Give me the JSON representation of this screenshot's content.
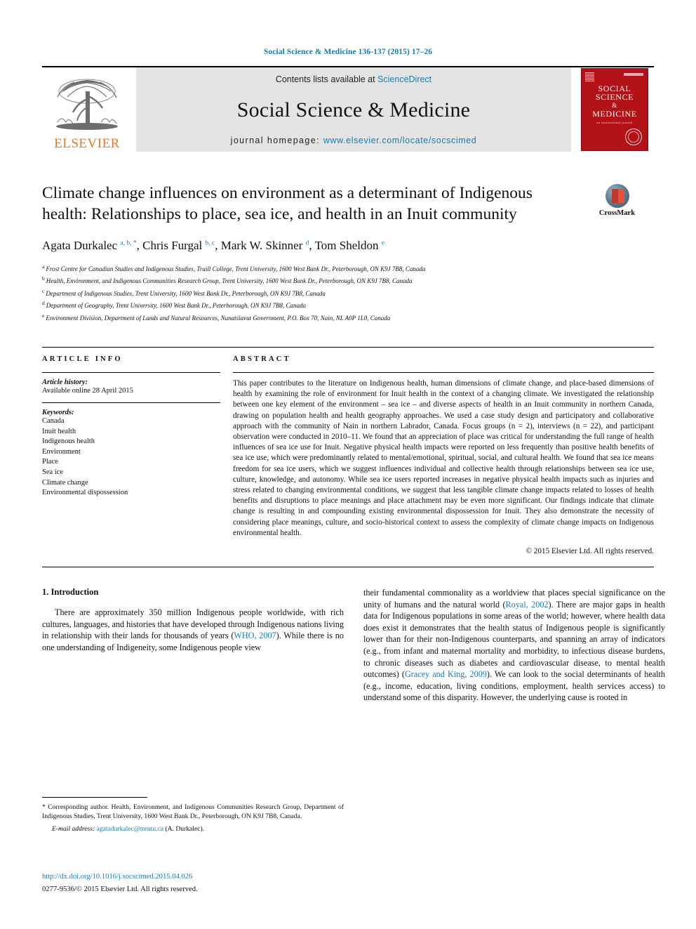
{
  "running_head": "Social Science & Medicine 136-137 (2015) 17–26",
  "header": {
    "elsevier_label": "ELSEVIER",
    "contents_prefix": "Contents lists available at ",
    "contents_link": "ScienceDirect",
    "journal_title": "Social Science & Medicine",
    "homepage_prefix": "journal homepage: ",
    "homepage_url": "www.elsevier.com/locate/socscimed",
    "cover": {
      "line1": "SOCIAL",
      "line2": "SCIENCE",
      "line3": "&",
      "line4": "MEDICINE",
      "subline": "an international journal"
    }
  },
  "crossmark": {
    "label": "CrossMark"
  },
  "article": {
    "title": "Climate change influences on environment as a determinant of Indigenous health: Relationships to place, sea ice, and health in an Inuit community",
    "authors": [
      {
        "name": "Agata Durkalec",
        "sups": "a, b, *"
      },
      {
        "name": "Chris Furgal",
        "sups": "b, c"
      },
      {
        "name": "Mark W. Skinner",
        "sups": "d"
      },
      {
        "name": "Tom Sheldon",
        "sups": "e"
      }
    ],
    "affiliations": [
      {
        "mark": "a",
        "text": "Frost Centre for Canadian Studies and Indigenous Studies, Traill College, Trent University, 1600 West Bank Dr., Peterborough, ON K9J 7B8, Canada"
      },
      {
        "mark": "b",
        "text": "Health, Environment, and Indigenous Communities Research Group, Trent University, 1600 West Bank Dr., Peterborough, ON K9J 7B8, Canada"
      },
      {
        "mark": "c",
        "text": "Department of Indigenous Studies, Trent University, 1600 West Bank Dr., Peterborough, ON K9J 7B8, Canada"
      },
      {
        "mark": "d",
        "text": "Department of Geography, Trent University, 1600 West Bank Dr., Peterborough, ON K9J 7B8, Canada"
      },
      {
        "mark": "e",
        "text": "Environment Division, Department of Lands and Natural Resources, Nunatsiavut Government, P.O. Box 70, Nain, NL A0P 1L0, Canada"
      }
    ]
  },
  "article_info": {
    "heading": "ARTICLE INFO",
    "history_label": "Article history:",
    "history_text": "Available online 28 April 2015",
    "keywords_label": "Keywords:",
    "keywords": [
      "Canada",
      "Inuit health",
      "Indigenous health",
      "Environment",
      "Place",
      "Sea ice",
      "Climate change",
      "Environmental dispossession"
    ]
  },
  "abstract": {
    "heading": "ABSTRACT",
    "text": "This paper contributes to the literature on Indigenous health, human dimensions of climate change, and place-based dimensions of health by examining the role of environment for Inuit health in the context of a changing climate. We investigated the relationship between one key element of the environment – sea ice – and diverse aspects of health in an Inuit community in northern Canada, drawing on population health and health geography approaches. We used a case study design and participatory and collaborative approach with the community of Nain in northern Labrador, Canada. Focus groups (n = 2), interviews (n = 22), and participant observation were conducted in 2010–11. We found that an appreciation of place was critical for understanding the full range of health influences of sea ice use for Inuit. Negative physical health impacts were reported on less frequently than positive health benefits of sea ice use, which were predominantly related to mental/emotional, spiritual, social, and cultural health. We found that sea ice means freedom for sea ice users, which we suggest influences individual and collective health through relationships between sea ice use, culture, knowledge, and autonomy. While sea ice users reported increases in negative physical health impacts such as injuries and stress related to changing environmental conditions, we suggest that less tangible climate change impacts related to losses of health benefits and disruptions to place meanings and place attachment may be even more significant. Our findings indicate that climate change is resulting in and compounding existing environmental dispossession for Inuit. They also demonstrate the necessity of considering place meanings, culture, and socio-historical context to assess the complexity of climate change impacts on Indigenous environmental health.",
    "copyright": "© 2015 Elsevier Ltd. All rights reserved."
  },
  "body": {
    "section_heading": "1. Introduction",
    "left_para_1": "There are approximately 350 million Indigenous people worldwide, with rich cultures, languages, and histories that have developed through Indigenous nations living in relationship with their lands for thousands of years (",
    "left_ref_1": "WHO, 2007",
    "left_para_1b": "). While there is no one understanding of Indigeneity, some Indigenous people view",
    "right_para_1a": "their fundamental commonality as a worldview that places special significance on the unity of humans and the natural world (",
    "right_ref_1": "Royal, 2002",
    "right_para_1b": "). There are major gaps in health data for Indigenous populations in some areas of the world; however, where health data does exist it demonstrates that the health status of Indigenous people is significantly lower than for their non-Indigenous counterparts, and spanning an array of indicators (e.g., from infant and maternal mortality and morbidity, to infectious disease burdens, to chronic diseases such as diabetes and cardiovascular disease, to mental health outcomes) (",
    "right_ref_2": "Gracey and King, 2009",
    "right_para_1c": "). We can look to the social determinants of health (e.g., income, education, living conditions, employment, health services access) to understand some of this disparity. However, the underlying cause is rooted in"
  },
  "footnote": {
    "star": "*",
    "text": "Corresponding author. Health, Environment, and Indigenous Communities Research Group, Department of Indigenous Studies, Trent University, 1600 West Bank Dr., Peterborough, ON K9J 7B8, Canada.",
    "email_label": "E-mail address:",
    "email": "agatadurkalec@trentu.ca",
    "email_suffix": " (A. Durkalec)."
  },
  "footer": {
    "doi": "http://dx.doi.org/10.1016/j.socscimed.2015.04.026",
    "issn": "0277-9536/© 2015 Elsevier Ltd. All rights reserved."
  },
  "colors": {
    "link": "#1a7bb0",
    "elsevier_orange": "#E87722",
    "cover_red": "#b11117",
    "band_gray": "#e4e4e4"
  }
}
